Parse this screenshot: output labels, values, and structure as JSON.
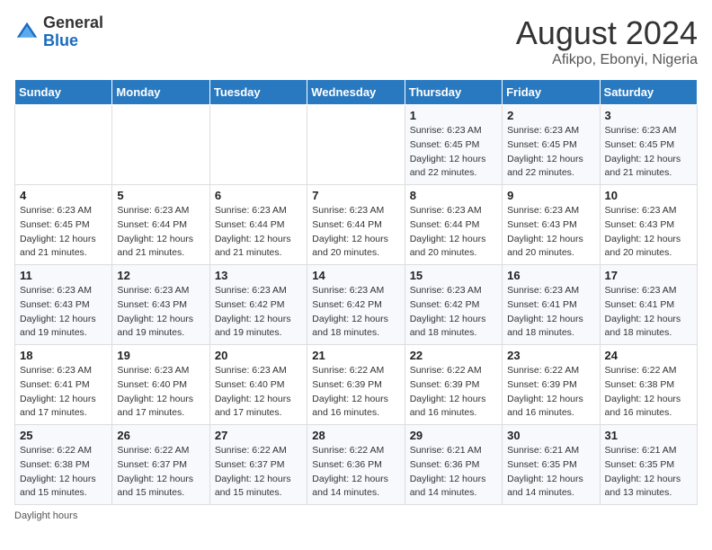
{
  "header": {
    "logo_general": "General",
    "logo_blue": "Blue",
    "month_year": "August 2024",
    "location": "Afikpo, Ebonyi, Nigeria"
  },
  "weekdays": [
    "Sunday",
    "Monday",
    "Tuesday",
    "Wednesday",
    "Thursday",
    "Friday",
    "Saturday"
  ],
  "weeks": [
    [
      {
        "day": "",
        "info": ""
      },
      {
        "day": "",
        "info": ""
      },
      {
        "day": "",
        "info": ""
      },
      {
        "day": "",
        "info": ""
      },
      {
        "day": "1",
        "info": "Sunrise: 6:23 AM\nSunset: 6:45 PM\nDaylight: 12 hours\nand 22 minutes."
      },
      {
        "day": "2",
        "info": "Sunrise: 6:23 AM\nSunset: 6:45 PM\nDaylight: 12 hours\nand 22 minutes."
      },
      {
        "day": "3",
        "info": "Sunrise: 6:23 AM\nSunset: 6:45 PM\nDaylight: 12 hours\nand 21 minutes."
      }
    ],
    [
      {
        "day": "4",
        "info": "Sunrise: 6:23 AM\nSunset: 6:45 PM\nDaylight: 12 hours\nand 21 minutes."
      },
      {
        "day": "5",
        "info": "Sunrise: 6:23 AM\nSunset: 6:44 PM\nDaylight: 12 hours\nand 21 minutes."
      },
      {
        "day": "6",
        "info": "Sunrise: 6:23 AM\nSunset: 6:44 PM\nDaylight: 12 hours\nand 21 minutes."
      },
      {
        "day": "7",
        "info": "Sunrise: 6:23 AM\nSunset: 6:44 PM\nDaylight: 12 hours\nand 20 minutes."
      },
      {
        "day": "8",
        "info": "Sunrise: 6:23 AM\nSunset: 6:44 PM\nDaylight: 12 hours\nand 20 minutes."
      },
      {
        "day": "9",
        "info": "Sunrise: 6:23 AM\nSunset: 6:43 PM\nDaylight: 12 hours\nand 20 minutes."
      },
      {
        "day": "10",
        "info": "Sunrise: 6:23 AM\nSunset: 6:43 PM\nDaylight: 12 hours\nand 20 minutes."
      }
    ],
    [
      {
        "day": "11",
        "info": "Sunrise: 6:23 AM\nSunset: 6:43 PM\nDaylight: 12 hours\nand 19 minutes."
      },
      {
        "day": "12",
        "info": "Sunrise: 6:23 AM\nSunset: 6:43 PM\nDaylight: 12 hours\nand 19 minutes."
      },
      {
        "day": "13",
        "info": "Sunrise: 6:23 AM\nSunset: 6:42 PM\nDaylight: 12 hours\nand 19 minutes."
      },
      {
        "day": "14",
        "info": "Sunrise: 6:23 AM\nSunset: 6:42 PM\nDaylight: 12 hours\nand 18 minutes."
      },
      {
        "day": "15",
        "info": "Sunrise: 6:23 AM\nSunset: 6:42 PM\nDaylight: 12 hours\nand 18 minutes."
      },
      {
        "day": "16",
        "info": "Sunrise: 6:23 AM\nSunset: 6:41 PM\nDaylight: 12 hours\nand 18 minutes."
      },
      {
        "day": "17",
        "info": "Sunrise: 6:23 AM\nSunset: 6:41 PM\nDaylight: 12 hours\nand 18 minutes."
      }
    ],
    [
      {
        "day": "18",
        "info": "Sunrise: 6:23 AM\nSunset: 6:41 PM\nDaylight: 12 hours\nand 17 minutes."
      },
      {
        "day": "19",
        "info": "Sunrise: 6:23 AM\nSunset: 6:40 PM\nDaylight: 12 hours\nand 17 minutes."
      },
      {
        "day": "20",
        "info": "Sunrise: 6:23 AM\nSunset: 6:40 PM\nDaylight: 12 hours\nand 17 minutes."
      },
      {
        "day": "21",
        "info": "Sunrise: 6:22 AM\nSunset: 6:39 PM\nDaylight: 12 hours\nand 16 minutes."
      },
      {
        "day": "22",
        "info": "Sunrise: 6:22 AM\nSunset: 6:39 PM\nDaylight: 12 hours\nand 16 minutes."
      },
      {
        "day": "23",
        "info": "Sunrise: 6:22 AM\nSunset: 6:39 PM\nDaylight: 12 hours\nand 16 minutes."
      },
      {
        "day": "24",
        "info": "Sunrise: 6:22 AM\nSunset: 6:38 PM\nDaylight: 12 hours\nand 16 minutes."
      }
    ],
    [
      {
        "day": "25",
        "info": "Sunrise: 6:22 AM\nSunset: 6:38 PM\nDaylight: 12 hours\nand 15 minutes."
      },
      {
        "day": "26",
        "info": "Sunrise: 6:22 AM\nSunset: 6:37 PM\nDaylight: 12 hours\nand 15 minutes."
      },
      {
        "day": "27",
        "info": "Sunrise: 6:22 AM\nSunset: 6:37 PM\nDaylight: 12 hours\nand 15 minutes."
      },
      {
        "day": "28",
        "info": "Sunrise: 6:22 AM\nSunset: 6:36 PM\nDaylight: 12 hours\nand 14 minutes."
      },
      {
        "day": "29",
        "info": "Sunrise: 6:21 AM\nSunset: 6:36 PM\nDaylight: 12 hours\nand 14 minutes."
      },
      {
        "day": "30",
        "info": "Sunrise: 6:21 AM\nSunset: 6:35 PM\nDaylight: 12 hours\nand 14 minutes."
      },
      {
        "day": "31",
        "info": "Sunrise: 6:21 AM\nSunset: 6:35 PM\nDaylight: 12 hours\nand 13 minutes."
      }
    ]
  ],
  "footer": {
    "daylight_label": "Daylight hours"
  }
}
